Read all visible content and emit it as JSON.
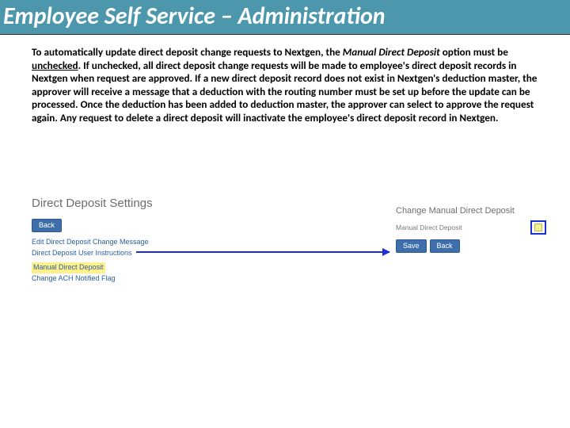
{
  "title": "Employee Self Service – Administration",
  "body": {
    "p1a": "To automatically update direct deposit change requests to Nextgen, the ",
    "mdd": "Manual Direct Deposit",
    "p1b": " option must be ",
    "unchecked": "unchecked",
    "p1c": ". If unchecked, all direct deposit change requests will be made to employee's direct deposit records in Nextgen when request are approved.  If a new direct deposit record does not exist in Nextgen's deduction master, the approver will receive a message that a deduction with the routing number must be set up before the update can be processed.  Once the deduction has been added to deduction master, the approver can select to approve the request again. Any request to delete a direct deposit will inactivate the employee's direct deposit record in Nextgen."
  },
  "left": {
    "title": "Direct Deposit Settings",
    "back": "Back",
    "links": [
      "Edit Direct Deposit Change Message",
      "Direct Deposit User Instructions",
      "Manual Direct Deposit",
      "Change ACH Notified Flag"
    ]
  },
  "right": {
    "title": "Change Manual Direct Deposit",
    "field": "Manual Direct Deposit",
    "save": "Save",
    "back": "Back"
  }
}
